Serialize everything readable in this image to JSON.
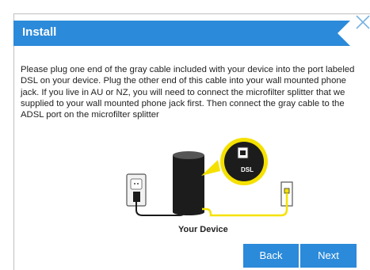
{
  "dialog": {
    "title": "Install",
    "message": "Please plug one end of the gray cable included with your device into the port labeled DSL on your device. Plug the other end of this cable into your wall mounted phone jack. If you live in AU or NZ, you will need to connect the microfilter splitter that we supplied to your wall mounted phone jack first. Then connect the gray cable to the ADSL port on the microfilter splitter",
    "accent_color": "#2b8ad9"
  },
  "illustration": {
    "port_label": "DSL",
    "device_label": "Your Device"
  },
  "buttons": {
    "back": "Back",
    "next": "Next"
  },
  "icons": {
    "close": "close-icon"
  }
}
